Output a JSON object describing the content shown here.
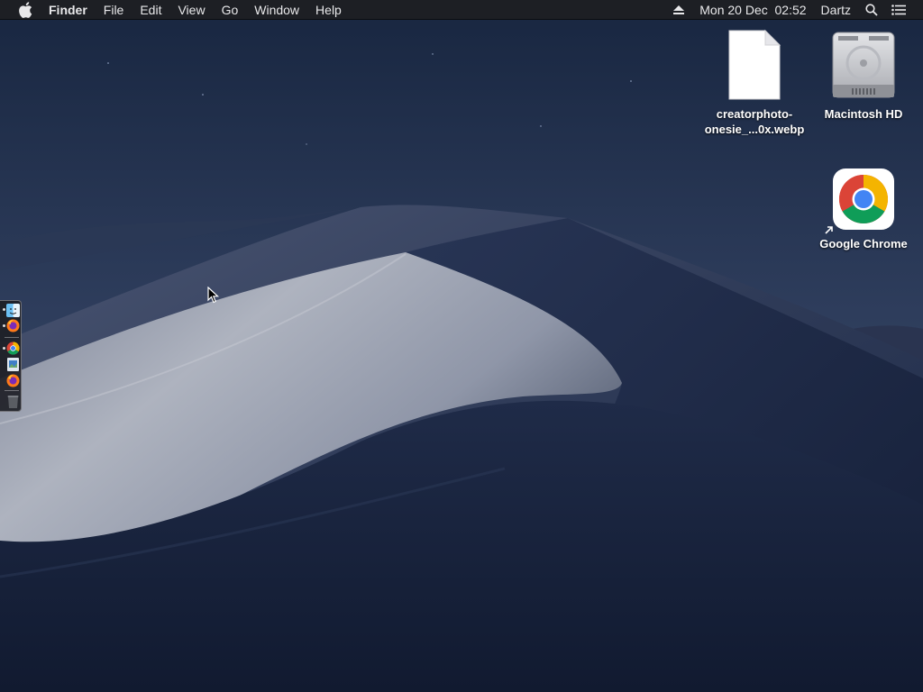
{
  "menubar": {
    "apple_icon": "apple-logo-icon",
    "app_name": "Finder",
    "items": [
      "File",
      "Edit",
      "View",
      "Go",
      "Window",
      "Help"
    ],
    "clock": "Mon 20 Dec  02:52",
    "user": "Dartz",
    "icons": [
      "eject-icon",
      "spotlight-search-icon",
      "notification-center-icon"
    ]
  },
  "desktop": {
    "icons": [
      {
        "label_line1": "creatorphoto-",
        "label_line2": "onesie_...0x.webp",
        "icon": "document-file-icon"
      },
      {
        "label": "Macintosh HD",
        "icon": "hard-drive-icon"
      },
      {
        "label": "Google Chrome",
        "icon": "chrome-app-icon",
        "alias": true
      }
    ]
  },
  "dock": {
    "items": [
      {
        "name": "Finder",
        "icon": "finder-icon",
        "running": true
      },
      {
        "name": "Firefox",
        "icon": "firefox-icon",
        "running": true
      },
      {
        "name": "Google Chrome",
        "icon": "chrome-icon",
        "running": true
      },
      {
        "name": "Preview",
        "icon": "preview-icon",
        "running": false
      },
      {
        "name": "Firefox",
        "icon": "firefox-icon",
        "running": false
      },
      {
        "name": "Trash",
        "icon": "trash-icon",
        "running": false
      }
    ]
  },
  "colors": {
    "menubar_bg": "#1d1f24",
    "sky_top": "#1b2a44",
    "sky_bottom": "#3b4a68",
    "dune_light": "#a7acb8",
    "dune_shadow": "#1a2540"
  }
}
